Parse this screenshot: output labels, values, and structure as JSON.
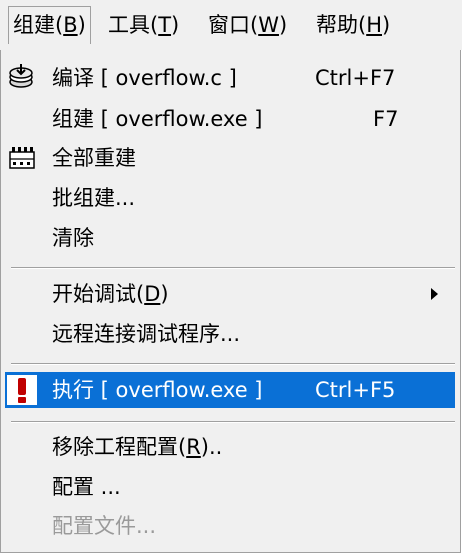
{
  "menubar": {
    "items": [
      {
        "label": "组建(",
        "key": "B",
        "suffix": ")"
      },
      {
        "label": "工具(",
        "key": "T",
        "suffix": ")"
      },
      {
        "label": "窗口(",
        "key": "W",
        "suffix": ")"
      },
      {
        "label": "帮助(",
        "key": "H",
        "suffix": ")"
      }
    ]
  },
  "dropdown": {
    "compile": {
      "label": "编译 [ overflow.c ]",
      "shortcut": "Ctrl+F7",
      "icon": "compile-icon"
    },
    "build": {
      "label": "组建 [ overflow.exe ]",
      "shortcut": "F7"
    },
    "rebuild_all": {
      "label": "全部重建",
      "icon": "rebuild-all-icon"
    },
    "batch_build": {
      "label": "批组建..."
    },
    "clean": {
      "label": "清除"
    },
    "start_debug": {
      "label_prefix": "开始调试(",
      "key": "D",
      "label_suffix": ")",
      "has_submenu": true
    },
    "remote_debug": {
      "label": "远程连接调试程序..."
    },
    "execute": {
      "label": "执行 [ overflow.exe ]",
      "shortcut": "Ctrl+F5",
      "icon": "exclamation-icon"
    },
    "remove_config": {
      "label_prefix": "移除工程配置(",
      "key": "R",
      "label_suffix": ").."
    },
    "configure": {
      "label": "配置 ..."
    },
    "config_file": {
      "label": "配置文件...",
      "disabled": true
    }
  },
  "colors": {
    "highlight": "#0a70d6",
    "menu_bg": "#f0f0f0",
    "exclamation": "#c00000",
    "disabled_text": "#9a9a9a"
  }
}
